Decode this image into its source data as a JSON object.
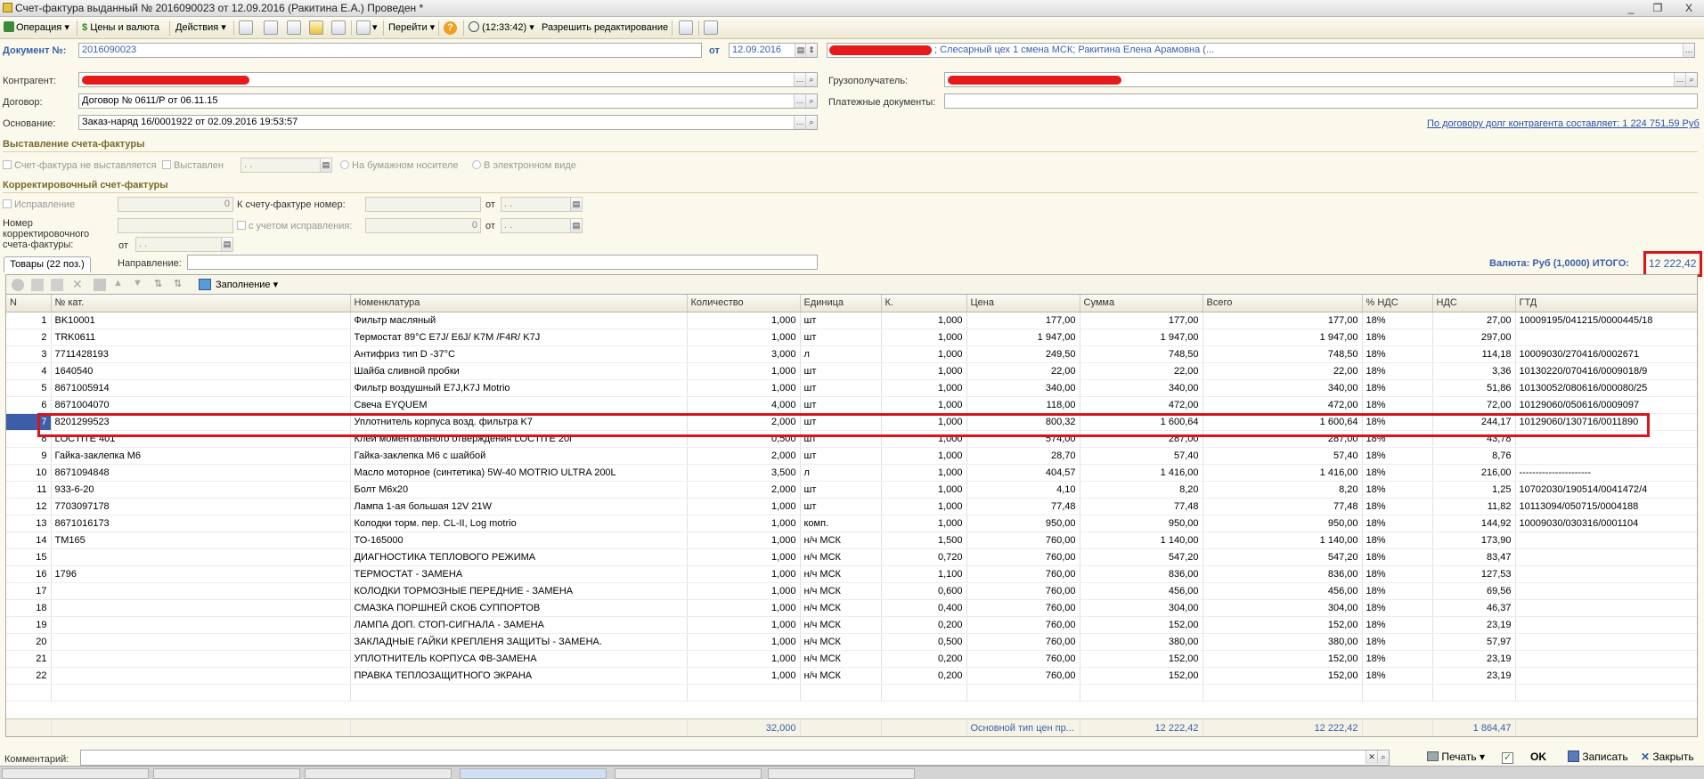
{
  "window": {
    "title": "Счет-фактура выданный № 2016090023 от 12.09.2016 (Ракитина Е.А.) Проведен *",
    "minimize": "_",
    "maximize": "❐",
    "close": "X"
  },
  "toolbar": {
    "operation": "Операция",
    "prices_currency": "Цены и валюта",
    "actions": "Действия",
    "go_to": "Перейти",
    "help": "?",
    "time": "(12:33:42)",
    "allow_edit": "Разрешить редактирование"
  },
  "header": {
    "doc_label": "Документ №:",
    "doc_number": "2016090023",
    "date_label": "от",
    "date": "12.09.2016",
    "responsible": "; Слесарный цех 1 смена МСК; Ракитина Елена Арамовна (..."
  },
  "counterparty": {
    "label": "Контрагент:",
    "value": ""
  },
  "contract": {
    "label": "Договор:",
    "value": "Договор № 0611/Р от 06.11.15"
  },
  "basis": {
    "label": "Основание:",
    "value": "Заказ-наряд 16/0001922 от 02.09.2016 19:53:57"
  },
  "consignee": {
    "label": "Грузополучатель:",
    "value": ""
  },
  "payment_docs": {
    "label": "Платежные документы:",
    "value": ""
  },
  "debt_link": "По договору долг контрагента составляет: 1 224 751,59 Руб",
  "invoice_issue": {
    "section": "Выставление счета-фактуры",
    "not_issued": "Счет-фактура не выставляется",
    "issued": "Выставлен",
    "issued_date": ". .",
    "paper": "На бумажном носителе",
    "electronic": "В электронном виде"
  },
  "correction": {
    "section": "Корректировочный счет-фактуры",
    "fix_label": "Исправление",
    "fix_value": "0",
    "to_invoice_label": "К счету-фактуре номер:",
    "from1": "от",
    "date1": ". .",
    "corr_number_label": "Номер корректировочного счета-фактуры:",
    "with_fix_label": "с учетом исправления:",
    "with_fix_value": "0",
    "from2": "от",
    "date2": ". .",
    "from3": "от",
    "date3": ". ."
  },
  "tabs": {
    "goods": "Товары (22 поз.)",
    "direction_label": "Направление:"
  },
  "currency_total": {
    "label": "Валюта: Руб (1,0000) ИТОГО:",
    "value": "12 222,42"
  },
  "grid_toolbar": {
    "fill": "Заполнение"
  },
  "columns": [
    "N",
    "№ кат.",
    "Номенклатура",
    "Количество",
    "Единица",
    "К.",
    "Цена",
    "Сумма",
    "Всего",
    "% НДС",
    "НДС",
    "ГТД"
  ],
  "rows": [
    [
      "1",
      "BK10001",
      "Фильтр масляный",
      "1,000",
      "шт",
      "1,000",
      "177,00",
      "177,00",
      "177,00",
      "18%",
      "27,00",
      "10009195/041215/0000445/18"
    ],
    [
      "2",
      "TRK0611",
      "Термостат 89°C E7J/ E6J/ K7M /F4R/ K7J",
      "1,000",
      "шт",
      "1,000",
      "1 947,00",
      "1 947,00",
      "1 947,00",
      "18%",
      "297,00",
      ""
    ],
    [
      "3",
      "7711428193",
      "Антифриз тип D -37°C",
      "3,000",
      "л",
      "1,000",
      "249,50",
      "748,50",
      "748,50",
      "18%",
      "114,18",
      "10009030/270416/0002671"
    ],
    [
      "4",
      "1640540",
      "Шайба сливной пробки",
      "1,000",
      "шт",
      "1,000",
      "22,00",
      "22,00",
      "22,00",
      "18%",
      "3,36",
      "10130220/070416/0009018/9"
    ],
    [
      "5",
      "8671005914",
      "Фильтр воздушный E7J,K7J Motrio",
      "1,000",
      "шт",
      "1,000",
      "340,00",
      "340,00",
      "340,00",
      "18%",
      "51,86",
      "10130052/080616/000080/25"
    ],
    [
      "6",
      "8671004070",
      "Свеча EYQUEM",
      "4,000",
      "шт",
      "1,000",
      "118,00",
      "472,00",
      "472,00",
      "18%",
      "72,00",
      "10129060/050616/0009097"
    ],
    [
      "7",
      "8201299523",
      "Уплотнитель корпуса возд. фильтра K7",
      "2,000",
      "шт",
      "1,000",
      "800,32",
      "1 600,64",
      "1 600,64",
      "18%",
      "244,17",
      "10129060/130716/0011890"
    ],
    [
      "8",
      "LOCTITE 401",
      "Клей  моментального отверждения  LOCTITE 20г",
      "0,500",
      "шт",
      "1,000",
      "574,00",
      "287,00",
      "287,00",
      "18%",
      "43,78",
      ""
    ],
    [
      "9",
      "Гайка-заклепка М6",
      "Гайка-заклепка М6 с шайбой",
      "2,000",
      "шт",
      "1,000",
      "28,70",
      "57,40",
      "57,40",
      "18%",
      "8,76",
      ""
    ],
    [
      "10",
      "8671094848",
      "Масло моторное (синтетика) 5W-40 MOTRIO ULTRA  200L",
      "3,500",
      "л",
      "1,000",
      "404,57",
      "1 416,00",
      "1 416,00",
      "18%",
      "216,00",
      "----------------------"
    ],
    [
      "11",
      "933-6-20",
      "Болт М6х20",
      "2,000",
      "шт",
      "1,000",
      "4,10",
      "8,20",
      "8,20",
      "18%",
      "1,25",
      "10702030/190514/0041472/4"
    ],
    [
      "12",
      "7703097178",
      "Лампа 1-ая большая 12V 21W",
      "1,000",
      "шт",
      "1,000",
      "77,48",
      "77,48",
      "77,48",
      "18%",
      "11,82",
      "10113094/050715/0004188"
    ],
    [
      "13",
      "8671016173",
      "Колодки торм. пер. CL-II, Log motrio",
      "1,000",
      "комп.",
      "1,000",
      "950,00",
      "950,00",
      "950,00",
      "18%",
      "144,92",
      "10009030/030316/0001104"
    ],
    [
      "14",
      "TM165",
      "ТО-165000",
      "1,000",
      "н/ч МСК",
      "1,500",
      "760,00",
      "1 140,00",
      "1 140,00",
      "18%",
      "173,90",
      ""
    ],
    [
      "15",
      "",
      "ДИАГНОСТИКА ТЕПЛОВОГО РЕЖИМА",
      "1,000",
      "н/ч МСК",
      "0,720",
      "760,00",
      "547,20",
      "547,20",
      "18%",
      "83,47",
      ""
    ],
    [
      "16",
      "1796",
      "ТЕРМОСТАТ - ЗАМЕНА",
      "1,000",
      "н/ч МСК",
      "1,100",
      "760,00",
      "836,00",
      "836,00",
      "18%",
      "127,53",
      ""
    ],
    [
      "17",
      "",
      "КОЛОДКИ ТОРМОЗНЫЕ ПЕРЕДНИЕ - ЗАМЕНА",
      "1,000",
      "н/ч МСК",
      "0,600",
      "760,00",
      "456,00",
      "456,00",
      "18%",
      "69,56",
      ""
    ],
    [
      "18",
      "",
      "СМАЗКА ПОРШНЕЙ СКОБ СУППОРТОВ",
      "1,000",
      "н/ч МСК",
      "0,400",
      "760,00",
      "304,00",
      "304,00",
      "18%",
      "46,37",
      ""
    ],
    [
      "19",
      "",
      "ЛАМПА ДОП. СТОП-СИГНАЛА - ЗАМЕНА",
      "1,000",
      "н/ч МСК",
      "0,200",
      "760,00",
      "152,00",
      "152,00",
      "18%",
      "23,19",
      ""
    ],
    [
      "20",
      "",
      "ЗАКЛАДНЫЕ ГАЙКИ КРЕПЛЕНЯ ЗАЩИТЫ - ЗАМЕНА.",
      "1,000",
      "н/ч МСК",
      "0,500",
      "760,00",
      "380,00",
      "380,00",
      "18%",
      "57,97",
      ""
    ],
    [
      "21",
      "",
      "УПЛОТНИТЕЛЬ КОРПУСА ФВ-ЗАМЕНА",
      "1,000",
      "н/ч МСК",
      "0,200",
      "760,00",
      "152,00",
      "152,00",
      "18%",
      "23,19",
      ""
    ],
    [
      "22",
      "",
      "ПРАВКА ТЕПЛОЗАЩИТНОГО ЭКРАНА",
      "1,000",
      "н/ч МСК",
      "0,200",
      "760,00",
      "152,00",
      "152,00",
      "18%",
      "23,19",
      ""
    ]
  ],
  "selected_row": 7,
  "footer": {
    "qty_total": "32,000",
    "price_type": "Основной тип цен пр...",
    "sum_total": "12 222,42",
    "total_total": "12 222,42",
    "vat_total": "1 864,47"
  },
  "comment": {
    "label": "Комментарий:",
    "value": ""
  },
  "buttons": {
    "print": "Печать",
    "ok": "OK",
    "save": "Записать",
    "close": "Закрыть"
  },
  "colors": {
    "background": "#fbf9ec",
    "section_title": "#7a6a2a",
    "link": "#2850b0",
    "selection": "#3c5ea8",
    "annotation_red": "#d8141c"
  }
}
